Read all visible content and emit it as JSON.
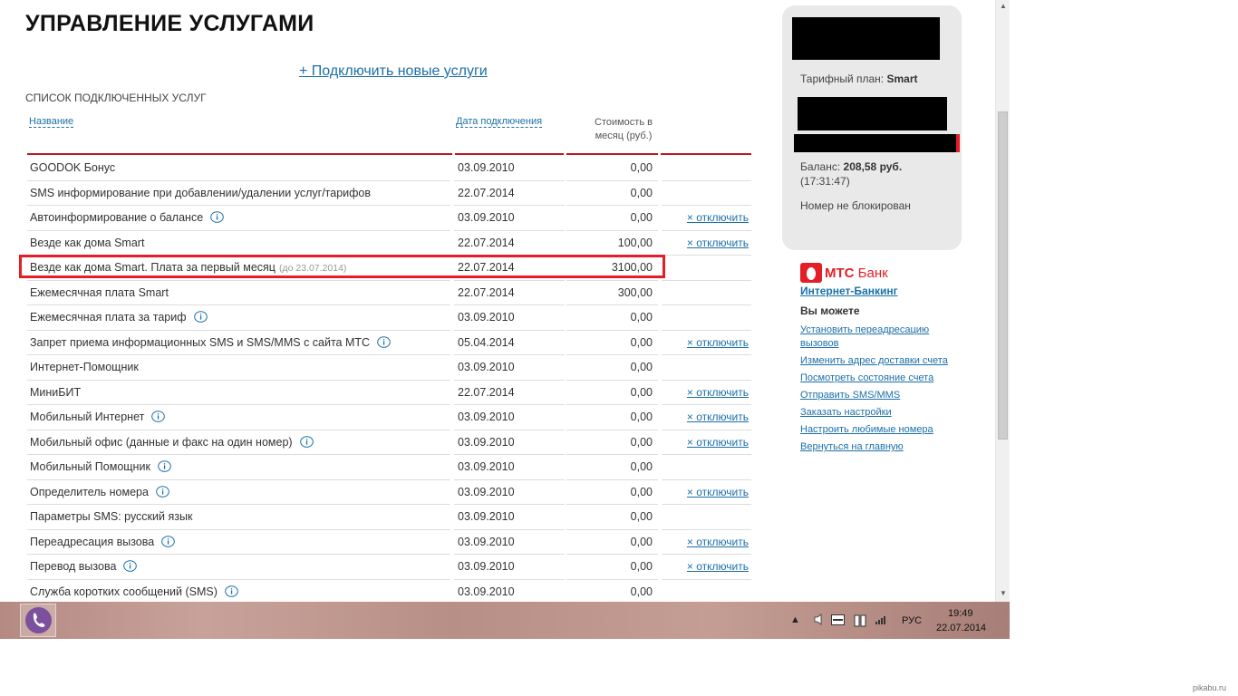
{
  "page": {
    "title": "УПРАВЛЕНИЕ УСЛУГАМИ",
    "add_services_link": "+ Подключить новые услуги",
    "list_title": "СПИСОК ПОДКЛЮЧЕННЫХ УСЛУГ"
  },
  "table": {
    "headers": {
      "name": "Название",
      "date": "Дата подключения",
      "cost_line1": "Стоимость в",
      "cost_line2": "месяц (руб.)"
    },
    "rows": [
      {
        "name": "GOODOK Бонус",
        "info": false,
        "note": "",
        "date": "03.09.2010",
        "cost": "0,00",
        "action": ""
      },
      {
        "name": "SMS информирование при добавлении/удалении услуг/тарифов",
        "info": false,
        "note": "",
        "date": "22.07.2014",
        "cost": "0,00",
        "action": ""
      },
      {
        "name": "Автоинформирование о балансе",
        "info": true,
        "note": "",
        "date": "03.09.2010",
        "cost": "0,00",
        "action": "× отключить"
      },
      {
        "name": "Везде как дома Smart",
        "info": false,
        "note": "",
        "date": "22.07.2014",
        "cost": "100,00",
        "action": "× отключить"
      },
      {
        "name": "Везде как дома Smart. Плата за первый месяц",
        "info": false,
        "note": "(до 23.07.2014)",
        "date": "22.07.2014",
        "cost": "3100,00",
        "action": ""
      },
      {
        "name": "Ежемесячная плата Smart",
        "info": false,
        "note": "",
        "date": "22.07.2014",
        "cost": "300,00",
        "action": ""
      },
      {
        "name": "Ежемесячная плата за тариф",
        "info": true,
        "note": "",
        "date": "03.09.2010",
        "cost": "0,00",
        "action": ""
      },
      {
        "name": "Запрет приема информационных SMS и SMS/MMS с сайта МТС",
        "info": true,
        "note": "",
        "date": "05.04.2014",
        "cost": "0,00",
        "action": "× отключить"
      },
      {
        "name": "Интернет-Помощник",
        "info": false,
        "note": "",
        "date": "03.09.2010",
        "cost": "0,00",
        "action": ""
      },
      {
        "name": "МиниБИТ",
        "info": false,
        "note": "",
        "date": "22.07.2014",
        "cost": "0,00",
        "action": "× отключить"
      },
      {
        "name": "Мобильный Интернет",
        "info": true,
        "note": "",
        "date": "03.09.2010",
        "cost": "0,00",
        "action": "× отключить"
      },
      {
        "name": "Мобильный офис (данные и факс на один номер)",
        "info": true,
        "note": "",
        "date": "03.09.2010",
        "cost": "0,00",
        "action": "× отключить"
      },
      {
        "name": "Мобильный Помощник",
        "info": true,
        "note": "",
        "date": "03.09.2010",
        "cost": "0,00",
        "action": ""
      },
      {
        "name": "Определитель номера",
        "info": true,
        "note": "",
        "date": "03.09.2010",
        "cost": "0,00",
        "action": "× отключить"
      },
      {
        "name": "Параметры SMS: русский язык",
        "info": false,
        "note": "",
        "date": "03.09.2010",
        "cost": "0,00",
        "action": ""
      },
      {
        "name": "Переадресация вызова",
        "info": true,
        "note": "",
        "date": "03.09.2010",
        "cost": "0,00",
        "action": "× отключить"
      },
      {
        "name": "Перевод вызова",
        "info": true,
        "note": "",
        "date": "03.09.2010",
        "cost": "0,00",
        "action": "× отключить"
      },
      {
        "name": "Служба коротких сообщений (SMS)",
        "info": true,
        "note": "",
        "date": "03.09.2010",
        "cost": "0,00",
        "action": ""
      }
    ]
  },
  "sidebar": {
    "tariff_label": "Тарифный план:",
    "tariff_value": "Smart",
    "balance_label": "Баланс:",
    "balance_value": "208,58 руб.",
    "balance_time": "(17:31:47)",
    "status": "Номер не блокирован"
  },
  "bank": {
    "title_mts": "МТС",
    "title_bank": "Банк",
    "internet_banking": "Интернет-Банкинг",
    "can_label": "Вы можете",
    "actions": [
      "Установить переадресацию вызовов",
      "Изменить адрес доставки счета",
      "Посмотреть состояние счета",
      "Отправить SMS/MMS",
      "Заказать настройки",
      "Настроить любимые номера",
      "Вернуться на главную"
    ]
  },
  "taskbar": {
    "language": "РУС",
    "time": "19:49",
    "date": "22.07.2014"
  },
  "watermark": "pikabu.ru",
  "colors": {
    "accent_red": "#e41e26",
    "link_blue": "#1b6fa8",
    "rule_red": "#c0151c"
  }
}
